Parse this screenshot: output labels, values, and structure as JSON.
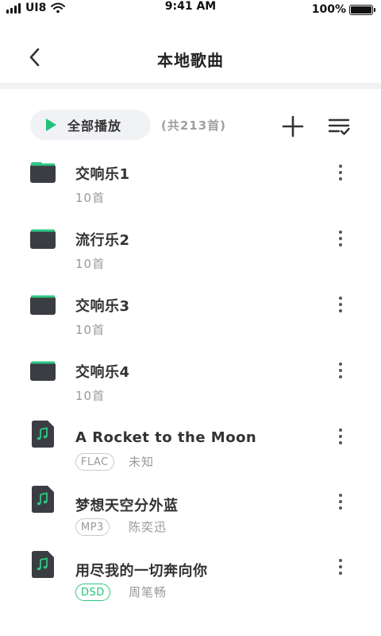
{
  "status_bar": {
    "carrier": "UI8",
    "time": "9:41 AM",
    "battery": "100%",
    "battery_level": 1.0
  },
  "nav": {
    "title": "本地歌曲",
    "back_icon": "chevron-left-icon"
  },
  "toolbar": {
    "play_all_label": "全部播放",
    "count_label": "(共213首)",
    "play_icon": "play-icon",
    "add_icon": "plus-icon",
    "sort_icon": "playlist-check-icon",
    "accent_color": "#22c27a"
  },
  "folders": [
    {
      "title": "交响乐1",
      "subtitle": "10首"
    },
    {
      "title": "流行乐2",
      "subtitle": "10首"
    },
    {
      "title": "交响乐3",
      "subtitle": "10首"
    },
    {
      "title": "交响乐4",
      "subtitle": "10首"
    }
  ],
  "songs": [
    {
      "title": "A Rocket to the Moon",
      "format": "FLAC",
      "artist": "未知"
    },
    {
      "title": "梦想天空分外蓝",
      "format": "MP3",
      "artist": "陈奕迅"
    },
    {
      "title": "用尽我的一切奔向你",
      "format": "DSD",
      "artist": "周笔畅"
    }
  ]
}
